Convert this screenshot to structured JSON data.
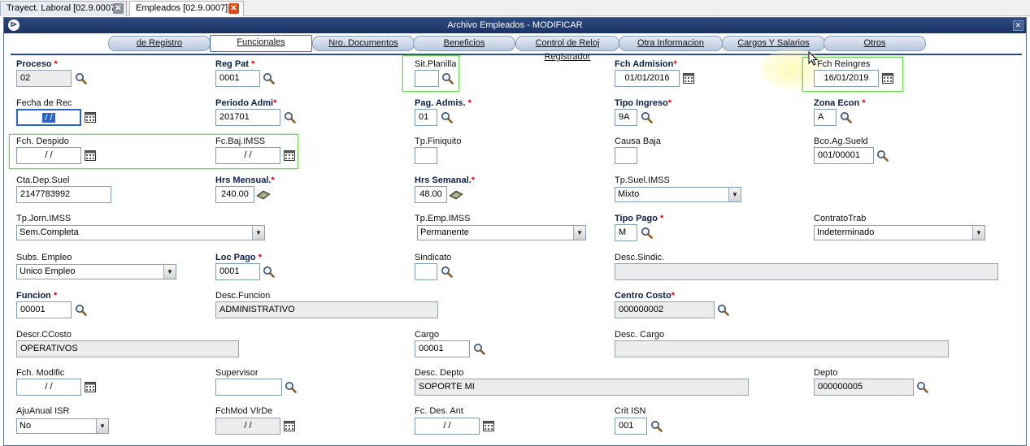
{
  "tabs": [
    {
      "label": "Trayect. Laboral [02.9.0007]"
    },
    {
      "label": "Empleados [02.9.0007]"
    }
  ],
  "window": {
    "title": "Archivo Empleados - MODIFICAR"
  },
  "subtabs": [
    "de Registro",
    "Funcionales",
    "Nro. Documentos",
    "Beneficios",
    "Control de Reloj Registrador",
    "Otra Informacion",
    "Cargos Y Salarios",
    "Otros"
  ],
  "active_subtab": "Funcionales",
  "fields": {
    "proceso": {
      "label": "Proceso",
      "value": "02"
    },
    "reg_pat": {
      "label": "Reg Pat",
      "value": "0001"
    },
    "sit_planilla": {
      "label": "Sit.Planilla",
      "value": ""
    },
    "fch_admision": {
      "label": "Fch Admision",
      "value": "01/01/2016"
    },
    "fch_reingres": {
      "label": "Fch Reingres",
      "value": "16/01/2019"
    },
    "fecha_rec": {
      "label": "Fecha de Rec",
      "value": " / /"
    },
    "periodo_admi": {
      "label": "Periodo Admi",
      "value": "201701"
    },
    "pag_admis": {
      "label": "Pag. Admis.",
      "value": "01"
    },
    "tipo_ingreso": {
      "label": "Tipo Ingreso",
      "value": "9A"
    },
    "zona_econ": {
      "label": "Zona Econ",
      "value": "A"
    },
    "fch_despido": {
      "label": "Fch. Despido",
      "value": "/ /"
    },
    "fc_baj_imss": {
      "label": "Fc.Baj.IMSS",
      "value": "/ /"
    },
    "tp_finiquito": {
      "label": "Tp.Finiquito",
      "value": ""
    },
    "causa_baja": {
      "label": "Causa Baja",
      "value": ""
    },
    "bco_ag_sueld": {
      "label": "Bco.Ag.Sueld",
      "value": "001/00001"
    },
    "cta_dep_suel": {
      "label": "Cta.Dep.Suel",
      "value": "2147783992"
    },
    "hrs_mensual": {
      "label": "Hrs Mensual.",
      "value": "240.00"
    },
    "hrs_semanal": {
      "label": "Hrs Semanal.",
      "value": "48.00"
    },
    "tp_suel_imss": {
      "label": "Tp.Suel.IMSS",
      "value": "Mixto"
    },
    "tp_jorn_imss": {
      "label": "Tp.Jorn.IMSS",
      "value": "Sem.Completa"
    },
    "tp_emp_imss": {
      "label": "Tp.Emp.IMSS",
      "value": "Permanente"
    },
    "tipo_pago": {
      "label": "Tipo Pago",
      "value": "M"
    },
    "contrato_trab": {
      "label": "ContratoTrab",
      "value": "Indeterminado"
    },
    "subs_empleo": {
      "label": "Subs. Empleo",
      "value": "Unico Empleo"
    },
    "loc_pago": {
      "label": "Loc Pago",
      "value": "0001"
    },
    "sindicato": {
      "label": "Sindicato",
      "value": ""
    },
    "desc_sindic": {
      "label": "Desc.Sindic.",
      "value": ""
    },
    "funcion": {
      "label": "Funcion",
      "value": "00001"
    },
    "desc_funcion": {
      "label": "Desc.Funcion",
      "value": "ADMINISTRATIVO"
    },
    "centro_costo": {
      "label": "Centro Costo",
      "value": "000000002"
    },
    "descr_ccosto": {
      "label": "Descr.CCosto",
      "value": "OPERATIVOS"
    },
    "cargo": {
      "label": "Cargo",
      "value": "00001"
    },
    "desc_cargo": {
      "label": "Desc. Cargo",
      "value": ""
    },
    "fch_modific": {
      "label": "Fch. Modific",
      "value": "/ /"
    },
    "supervisor": {
      "label": "Supervisor",
      "value": ""
    },
    "desc_depto": {
      "label": "Desc. Depto",
      "value": "SOPORTE MI"
    },
    "depto": {
      "label": "Depto",
      "value": "000000005"
    },
    "aju_anual_isr": {
      "label": "AjuAnual ISR",
      "value": "No"
    },
    "fchmod_vlrde": {
      "label": "FchMod VlrDe",
      "value": "/ /"
    },
    "fc_des_ant": {
      "label": "Fc. Des. Ant",
      "value": "/ /"
    },
    "crit_isn": {
      "label": "Crit ISN",
      "value": "001"
    }
  },
  "required_mark": "*",
  "icons": [
    "close-icon",
    "app-icon",
    "search-icon",
    "calendar-icon",
    "calculator-icon",
    "dropdown-arrow-icon",
    "mouse-cursor-icon"
  ],
  "colors": {
    "title_bar": "#1a3262",
    "required": "#e00000",
    "highlight_frame": "#6fd35a",
    "selection": "#2a64c8"
  }
}
